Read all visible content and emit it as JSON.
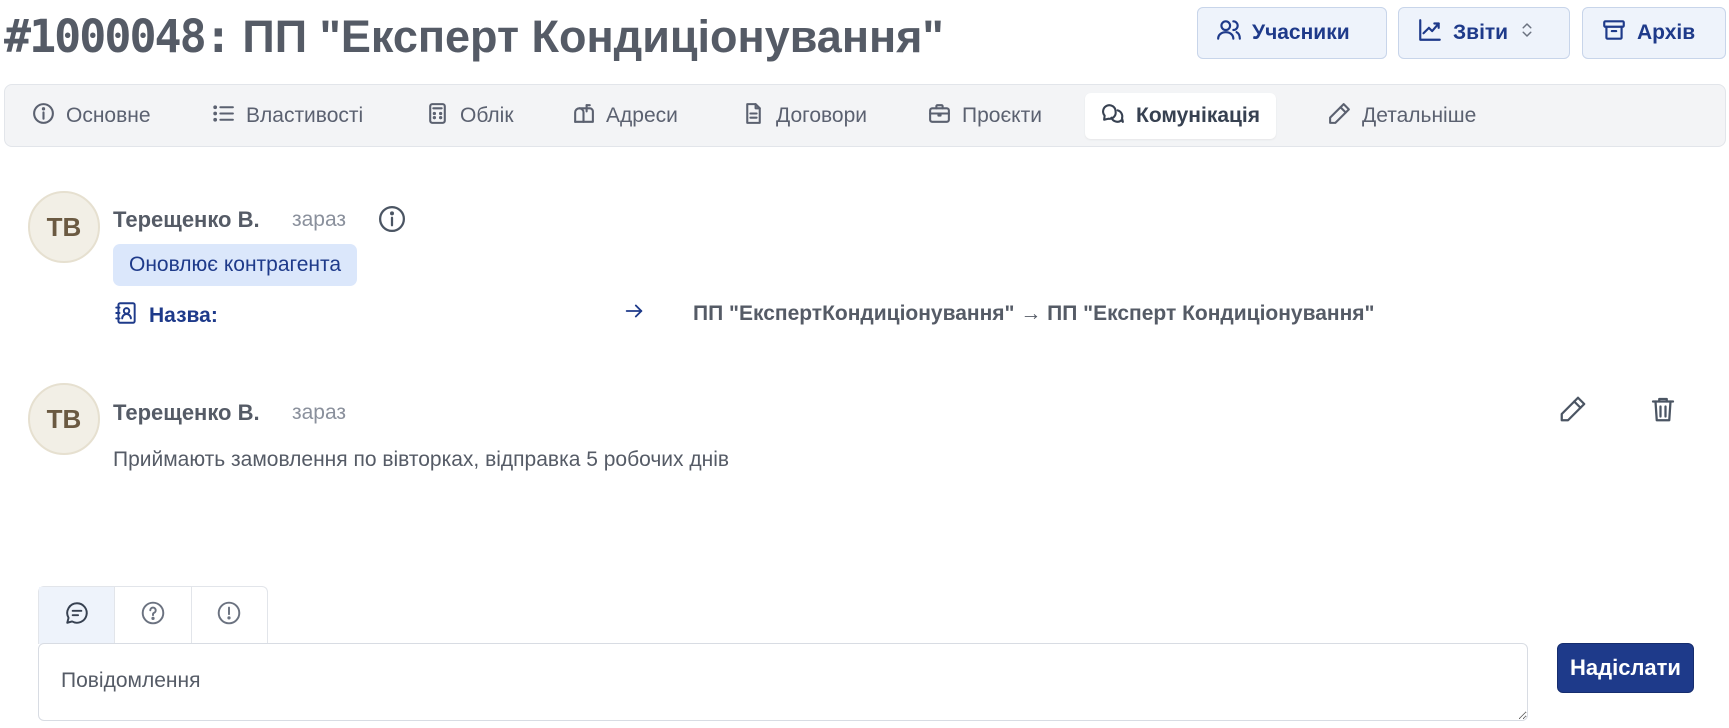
{
  "header": {
    "title_number": "#1000048:",
    "title_name": "ПП \"Експерт Кондиціонування\"",
    "buttons": [
      {
        "label": "Учасники",
        "icon": "users-icon"
      },
      {
        "label": "Звіти",
        "icon": "chart-line-icon"
      },
      {
        "label": "Архів",
        "icon": "archive-icon"
      }
    ]
  },
  "tabs": [
    {
      "label": "Основне",
      "icon": "info-circle-icon"
    },
    {
      "label": "Властивості",
      "icon": "list-icon"
    },
    {
      "label": "Облік",
      "icon": "calculator-icon"
    },
    {
      "label": "Адреси",
      "icon": "mailbox-icon"
    },
    {
      "label": "Договори",
      "icon": "document-icon"
    },
    {
      "label": "Проєкти",
      "icon": "briefcase-icon"
    },
    {
      "label": "Комунікація",
      "icon": "chat-bubbles-icon",
      "active": true
    },
    {
      "label": "Детальніше",
      "icon": "pencil-icon"
    }
  ],
  "feed": [
    {
      "initials": "ТВ",
      "author": "Терещенко В.",
      "time": "зараз",
      "badge": "Оновлює контрагента",
      "change": {
        "label": "Назва:",
        "value": "ПП \"ЕкспертКондиціонування\" → ПП \"Експерт Кондиціонування\""
      }
    },
    {
      "initials": "ТВ",
      "author": "Терещенко В.",
      "time": "зараз",
      "text": "Приймають замовлення по вівторках, відправка 5 робочих днів"
    }
  ],
  "composer": {
    "placeholder": "Повідомлення",
    "send_label": "Надіслати",
    "types": [
      "chat-icon",
      "question-circle-icon",
      "exclamation-circle-icon"
    ]
  },
  "colors": {
    "accent": "#1e3a8a",
    "badge_bg": "#dbe7fb",
    "tab_bar_bg": "#f3f4f6"
  }
}
